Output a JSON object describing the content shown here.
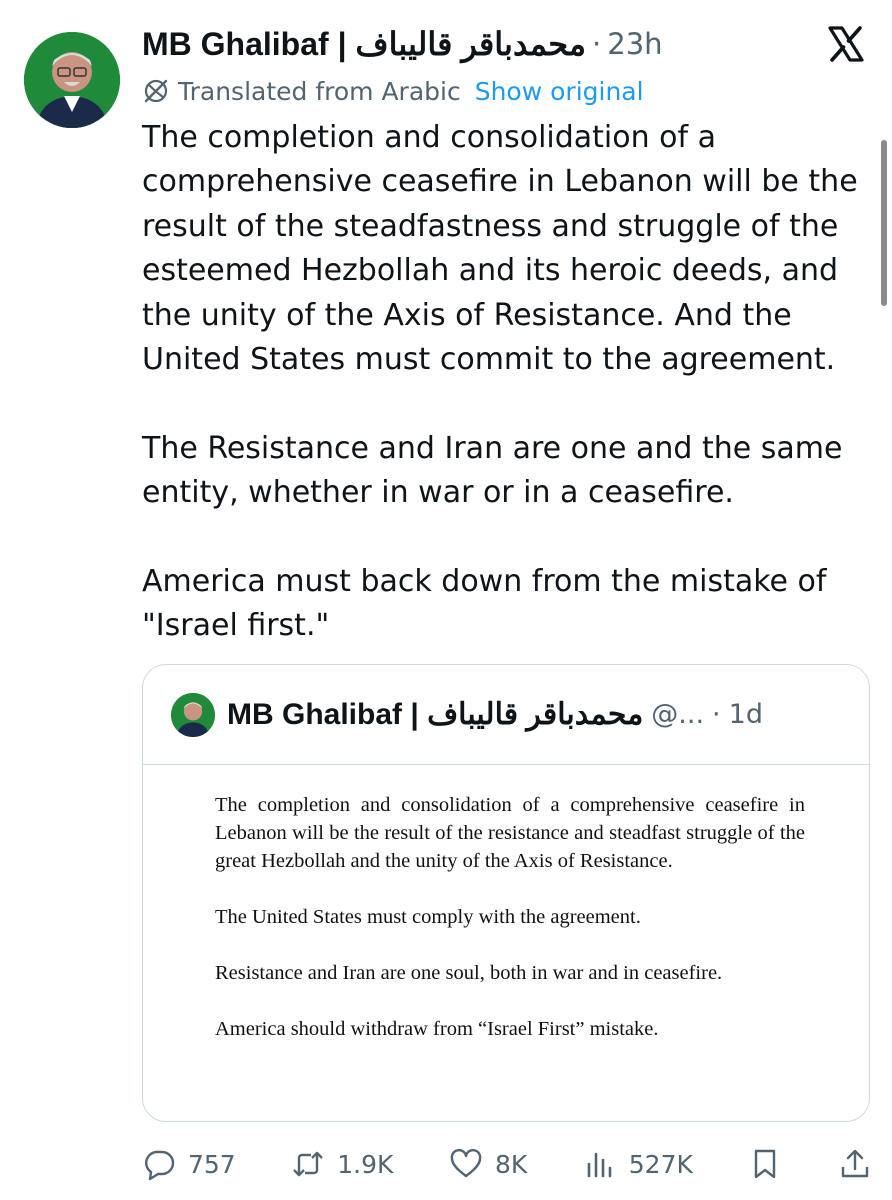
{
  "tweet": {
    "author_name": "MB Ghalibaf | محمدباقر قالیباف",
    "separator": "·",
    "time": "23h",
    "translated_label": "Translated from Arabic",
    "show_original_label": "Show original",
    "paragraphs": [
      "The completion and consolidation of a comprehensive ceasefire in Lebanon will be the result of the steadfastness and struggle of the esteemed Hezbollah and its heroic deeds, and the unity of the Axis of Resistance. And the United States must commit to the agreement.",
      "The Resistance and Iran are one and the same entity, whether in war or in a ceasefire.",
      "America must back down from the mistake of \"Israel first.\""
    ]
  },
  "quote": {
    "author_name": "MB Ghalibaf | محمدباقر قالیباف",
    "handle": "@...",
    "separator": "·",
    "time": "1d",
    "document": [
      "The completion and consolidation of a comprehensive ceasefire in Lebanon will be the result of the resistance and steadfast struggle of the great Hezbollah and the unity of the Axis of Resistance.",
      "The United States must comply with the agreement.",
      "Resistance and Iran are one soul, both in war and in ceasefire.",
      "America should withdraw from “Israel First” mistake."
    ]
  },
  "actions": {
    "replies": "757",
    "reposts": "1.9K",
    "likes": "8K",
    "views": "527K"
  },
  "icons": {
    "platform": "x-logo-icon",
    "translate": "globe-slash-icon",
    "reply": "comment-bubble-icon",
    "repost": "repost-arrows-icon",
    "like": "heart-icon",
    "views": "bar-chart-icon",
    "bookmark": "bookmark-icon",
    "share": "share-upload-icon"
  },
  "colors": {
    "link": "#1d9bf0",
    "secondary_text": "#536471",
    "border": "#cfd9de",
    "avatar_bg": "#1f8a3a"
  }
}
